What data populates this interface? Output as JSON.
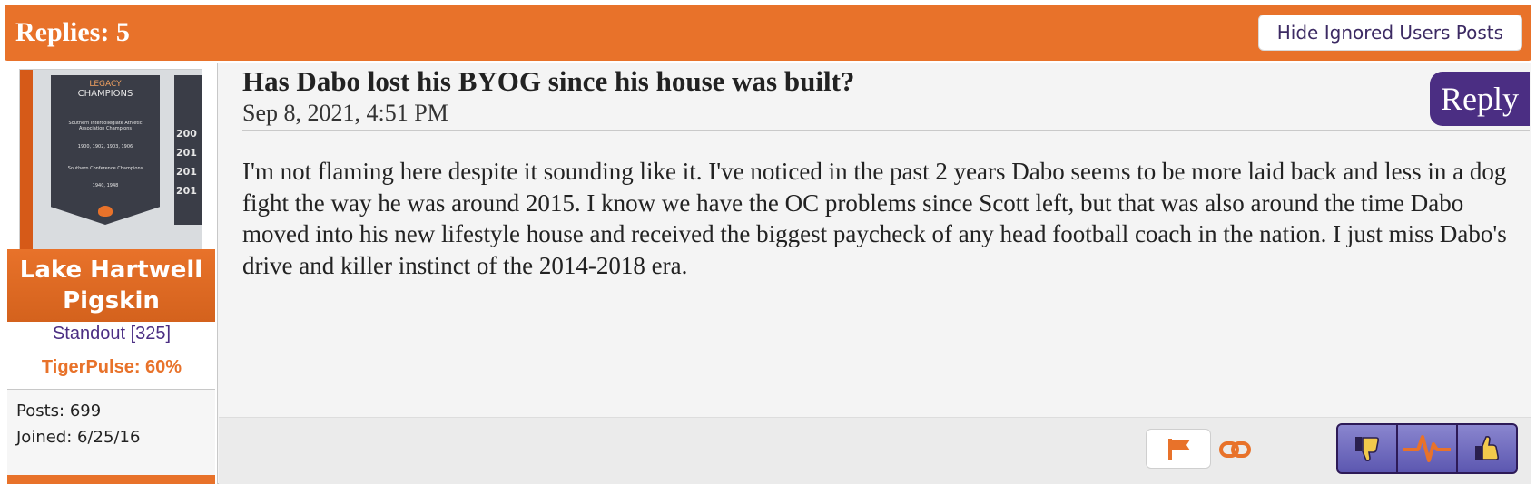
{
  "header": {
    "title": "Replies: 5",
    "hide_ignored_label": "Hide Ignored Users Posts"
  },
  "author": {
    "avatar_banner": {
      "line1": "LEGACY",
      "line2": "CHAMPIONS",
      "line3": "Southern Intercollegiate Athletic Association Champions",
      "line4": "1900, 1902, 1903, 1906",
      "line5": "Southern Conference Champions",
      "line6": "1940, 1948",
      "side_years": [
        "200",
        "201",
        "201",
        "201"
      ]
    },
    "username_line1": "Lake Hartwell",
    "username_line2": "Pigskin",
    "rank": "Standout [325]",
    "tiger_pulse": "TigerPulse: 60%",
    "posts": "Posts: 699",
    "joined": "Joined: 6/25/16"
  },
  "post": {
    "title": "Has Dabo lost his BYOG since his house was built?",
    "date": "Sep 8, 2021, 4:51 PM",
    "reply_label": "Reply",
    "body": "I'm not flaming here despite it sounding like it. I've noticed in the past 2 years Dabo seems to be more laid back and less in a dog fight the way he was around 2015. I know we have the OC problems since Scott left, but that was also around the time Dabo moved into his new lifestyle house and received the biggest paycheck of any head football coach in the nation. I just miss Dabo's drive and killer instinct of the 2014-2018 era."
  },
  "footer": {
    "icons": [
      "flag-icon",
      "link-icon",
      "thumbs-down-icon",
      "pulse-icon",
      "thumbs-up-icon"
    ]
  },
  "colors": {
    "orange": "#e8722a",
    "purple": "#4b2e83"
  }
}
